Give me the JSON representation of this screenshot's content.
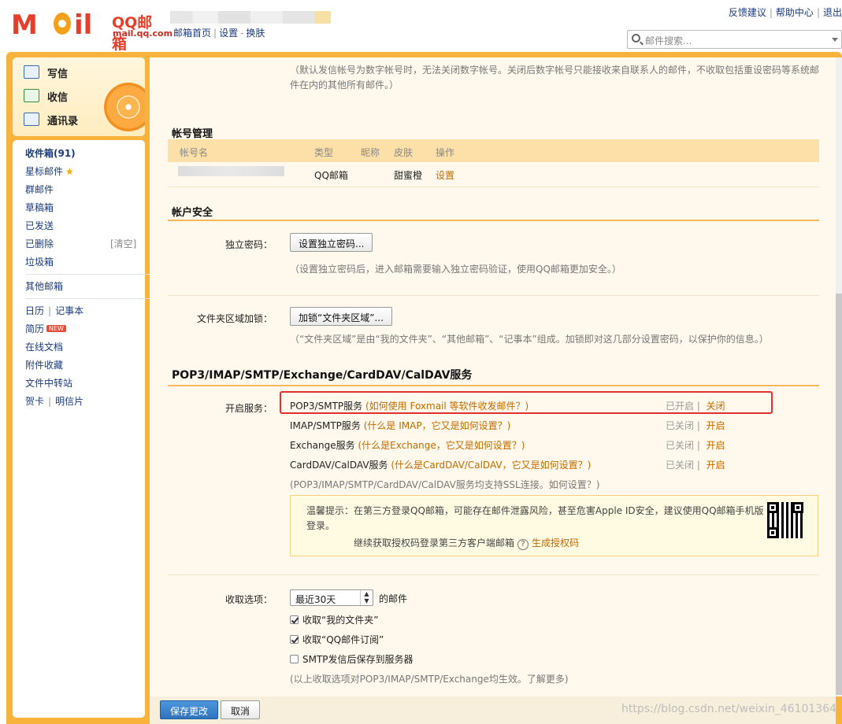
{
  "header": {
    "logo_letters_1": "M",
    "logo_letters_2": "il",
    "logo_qq": "QQ邮箱",
    "logo_domain": "mail.qq.com",
    "links": [
      "邮箱首页",
      "设置",
      "换肤"
    ],
    "right_links": [
      "反馈建议",
      "帮助中心",
      "退出"
    ],
    "search_placeholder": "邮件搜索..."
  },
  "quick": {
    "compose": "写信",
    "inbox": "收信",
    "contacts": "通讯录"
  },
  "folders": {
    "inbox": "收件箱(91)",
    "starred": "星标邮件",
    "group": "群邮件",
    "drafts": "草稿箱",
    "sent": "已发送",
    "deleted": "已删除",
    "clear": "[清空]",
    "spam": "垃圾箱",
    "other": "其他邮箱",
    "calendar": "日历",
    "notes": "记事本",
    "resume": "简历",
    "new_badge": "NEW",
    "docs": "在线文档",
    "attachments": "附件收藏",
    "transfer": "文件中转站",
    "cards": "贺卡",
    "postcards": "明信片"
  },
  "main": {
    "top_note_1": "（默认发信帐号为数字帐号时，无法关闭数字帐号。关闭后数字帐号只能接收来自联系人的邮件，不收取包括重设密码等系统邮",
    "top_note_2": "件在内的其他所有邮件。）",
    "account_mgmt": {
      "title": "帐号管理",
      "headers": [
        "帐号名",
        "类型",
        "昵称",
        "皮肤",
        "操作"
      ],
      "row": {
        "type": "QQ邮箱",
        "skin": "甜蜜橙",
        "action": "设置"
      }
    },
    "security": {
      "title": "帐户安全",
      "pw_label": "独立密码：",
      "pw_button": "设置独立密码...",
      "pw_note": "（设置独立密码后，进入邮箱需要输入独立密码验证，使用QQ邮箱更加安全。）",
      "lock_label": "文件夹区域加锁：",
      "lock_button": "加锁“文件夹区域”...",
      "lock_note": "（“文件夹区域”是由“我的文件夹”、“其他邮箱”、“记事本”组成。加锁即对这几部分设置密码，以保护你的信息。）"
    },
    "services": {
      "title": "POP3/IMAP/SMTP/Exchange/CardDAV/CalDAV服务",
      "label": "开启服务：",
      "items": [
        {
          "name": "POP3/SMTP服务",
          "help": "(如何使用 Foxmail 等软件收发邮件？)",
          "status": "已开启",
          "action": "关闭"
        },
        {
          "name": "IMAP/SMTP服务",
          "help": "(什么是 IMAP，它又是如何设置？)",
          "status": "已关闭",
          "action": "开启"
        },
        {
          "name": "Exchange服务",
          "help": "(什么是Exchange，它又是如何设置？)",
          "status": "已关闭",
          "action": "开启"
        },
        {
          "name": "CardDAV/CalDAV服务",
          "help": "(什么是CardDAV/CalDAV，它又是如何设置？)",
          "status": "已关闭",
          "action": "开启"
        }
      ],
      "ssl_note": "(POP3/IMAP/SMTP/CardDAV/CalDAV服务均支持SSL连接。如何设置？)",
      "tip_line": "温馨提示：在第三方登录QQ邮箱，可能存在邮件泄露风险，甚至危害Apple ID安全，建议使用QQ邮箱手机版登录。",
      "tip_auth": "继续获取授权码登录第三方客户端邮箱",
      "tip_qmark": "?",
      "tip_gen": "生成授权码"
    },
    "receive": {
      "label": "收取选项：",
      "range": "最近30天",
      "range_suffix": "的邮件",
      "opt1": "收取“我的文件夹”",
      "opt2": "收取“QQ邮件订阅”",
      "opt3": "SMTP发信后保存到服务器",
      "note": "(以上收取选项对POP3/IMAP/SMTP/Exchange均生效。了解更多)"
    }
  },
  "footer": {
    "save": "保存更改",
    "cancel": "取消",
    "watermark": "https://blog.csdn.net/weixin_46101364"
  }
}
